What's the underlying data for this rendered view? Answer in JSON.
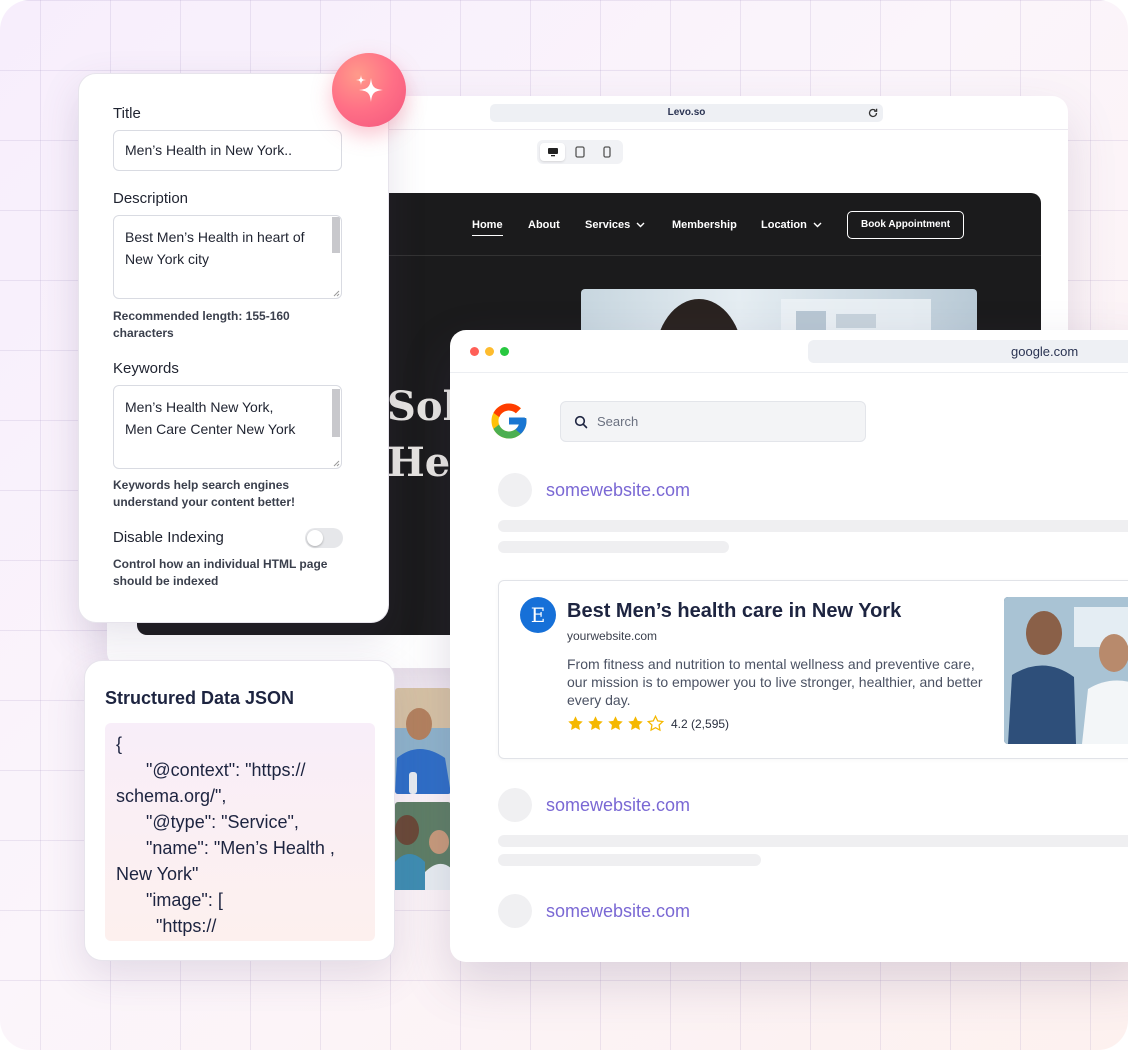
{
  "website_preview": {
    "address": "Levo.so",
    "nav": {
      "home": "Home",
      "about": "About",
      "services": "Services",
      "membership": "Membership",
      "location": "Location",
      "book": "Book Appointment"
    },
    "hero_line1": "Sol",
    "hero_line2": "Hea"
  },
  "seo_panel": {
    "title_label": "Title",
    "title_value": "Men’s Health in New York..",
    "description_label": "Description",
    "description_value": "Best Men’s Health in heart of New York city",
    "description_hint": "Recommended length: 155-160 characters",
    "keywords_label": "Keywords",
    "keywords_line1": "Men’s Health New York,",
    "keywords_line2": "Men Care Center New York",
    "keywords_hint": "Keywords help search engines understand your content better!",
    "indexing_label": "Disable Indexing",
    "indexing_enabled": false,
    "indexing_hint": "Control how an individual HTML page should be indexed"
  },
  "json_panel": {
    "title": "Structured Data JSON",
    "lines": [
      "{",
      "      \"@context\": \"https://",
      "schema.org/\",",
      "      \"@type\": \"Service\",",
      "      \"name\": \"Men’s Health ,",
      "New York\"",
      "      \"image\": [",
      "        \"https://"
    ]
  },
  "google": {
    "address": "google.com",
    "search_placeholder": "Search",
    "result_domain": "somewebsite.com",
    "featured": {
      "logo_letter": "E",
      "title": "Best Men’s health care in New York",
      "url": "yourwebsite.com",
      "description": "From fitness and nutrition to mental wellness and preventive care, our mission is to empower you to live stronger, healthier, and better every day.",
      "rating": 4.2,
      "rating_text": "4.2 (2,595)",
      "star_color": "#f5b800"
    }
  },
  "colors": {
    "accent_purple": "#7a68d4",
    "brand_blue": "#1670d8",
    "sparkle_pink": "#f2557d"
  }
}
